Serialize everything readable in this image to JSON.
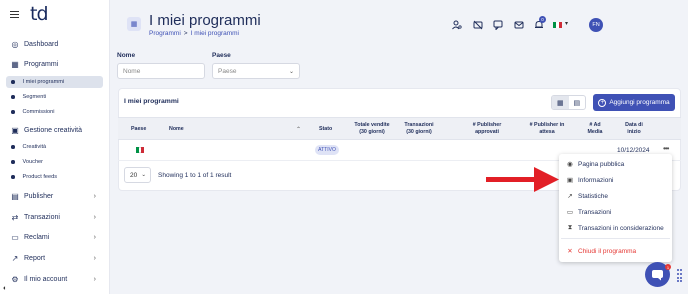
{
  "brand": {
    "logo": "td"
  },
  "sidebar": {
    "items": [
      {
        "label": "Dashboard",
        "icon": "dashboard-icon"
      },
      {
        "label": "Programmi",
        "icon": "programs-icon"
      },
      {
        "label": "Gestione creatività",
        "icon": "creative-icon"
      },
      {
        "label": "Publisher",
        "icon": "publisher-icon"
      },
      {
        "label": "Transazioni",
        "icon": "transactions-icon"
      },
      {
        "label": "Reclami",
        "icon": "claims-icon"
      },
      {
        "label": "Report",
        "icon": "report-icon"
      },
      {
        "label": "Il mio account",
        "icon": "account-icon"
      }
    ],
    "programmi_sub": [
      "I miei programmi",
      "Segmenti",
      "Commissioni"
    ],
    "creativita_sub": [
      "Creatività",
      "Voucher",
      "Product feeds"
    ]
  },
  "header": {
    "title": "I miei programmi",
    "breadcrumb": {
      "parent": "Programmi",
      "separator": ">",
      "current": "I miei programmi"
    },
    "notification_count": "0",
    "avatar_initials": "FN"
  },
  "filters": {
    "nome_label": "Nome",
    "nome_placeholder": "Nome",
    "paese_label": "Paese",
    "paese_placeholder": "Paese"
  },
  "card": {
    "title": "I miei programmi",
    "add_button": "Aggiungi programma"
  },
  "table": {
    "columns": [
      "Paese",
      "Nome",
      "Stato",
      "Totale vendite\n(30 giorni)",
      "Transazioni\n(30 giorni)",
      "# Publisher\napprovati",
      "# Publisher in\nattesa",
      "# Ad\nMedia",
      "Data di\ninizio"
    ],
    "rows": [
      {
        "country_flag": "it",
        "name": "",
        "status": "ATTIVO",
        "start_date": "10/12/2024"
      }
    ]
  },
  "pagination": {
    "per_page": "20",
    "showing": "Showing 1 to 1 of 1 result"
  },
  "context_menu": {
    "items": [
      {
        "label": "Pagina pubblica",
        "icon": "eye-icon"
      },
      {
        "label": "Informazioni",
        "icon": "info-icon"
      },
      {
        "label": "Statistiche",
        "icon": "stats-icon"
      },
      {
        "label": "Transazioni",
        "icon": "transactions-icon"
      },
      {
        "label": "Transazioni in considerazione",
        "icon": "pending-icon"
      },
      {
        "label": "Chiudi il programma",
        "icon": "close-icon"
      }
    ]
  },
  "chat": {
    "badge": "1"
  },
  "colors": {
    "primary": "#3f51b5",
    "danger": "#e53935",
    "arrow": "#e21f26",
    "flag_green": "#009246",
    "flag_red": "#ce2b37"
  }
}
